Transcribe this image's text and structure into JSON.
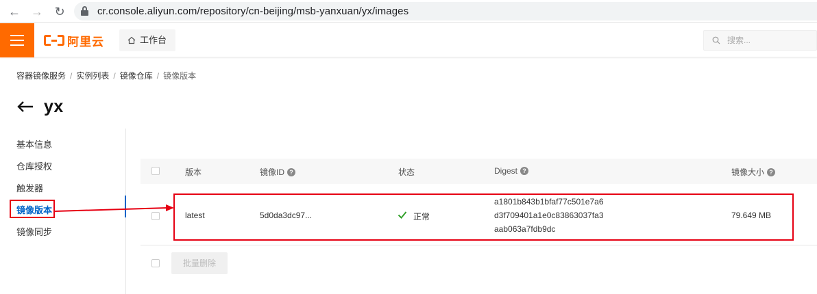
{
  "browser": {
    "url": "cr.console.aliyun.com/repository/cn-beijing/msb-yanxuan/yx/images"
  },
  "header": {
    "logo_text": "阿里云",
    "workbench_label": "工作台",
    "search_placeholder": "搜索..."
  },
  "breadcrumb": {
    "items": [
      "容器镜像服务",
      "实例列表",
      "镜像仓库",
      "镜像版本"
    ],
    "separator": "/"
  },
  "page": {
    "title": "yx"
  },
  "sidenav": {
    "items": [
      {
        "label": "基本信息",
        "active": false
      },
      {
        "label": "仓库授权",
        "active": false
      },
      {
        "label": "触发器",
        "active": false
      },
      {
        "label": "镜像版本",
        "active": true
      },
      {
        "label": "镜像同步",
        "active": false
      }
    ]
  },
  "table": {
    "columns": [
      "版本",
      "镜像ID",
      "状态",
      "Digest",
      "镜像大小"
    ],
    "rows": [
      {
        "version": "latest",
        "image_id": "5d0da3dc97...",
        "status": "正常",
        "digest": [
          "a1801b843b1bfaf77c501e7a6",
          "d3f709401a1e0c83863037fa3",
          "aab063a7fdb9dc"
        ],
        "size": "79.649 MB"
      }
    ],
    "batch_delete_label": "批量删除"
  },
  "colors": {
    "brand": "#ff6a00",
    "active_link": "#0064c8",
    "annotation_red": "#e60012",
    "status_ok": "#33a02c"
  }
}
